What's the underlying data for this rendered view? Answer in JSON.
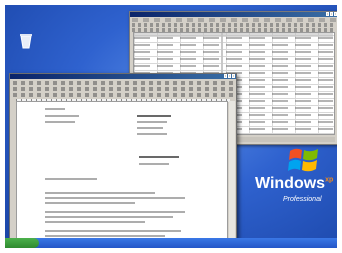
{
  "desktop": {
    "background_color": "#2f62cf",
    "logo": {
      "brand": "Windows",
      "superscript": "xp",
      "edition": "Professional"
    },
    "icons": [
      "recycle-bin-icon"
    ]
  },
  "windows": [
    {
      "app": "spreadsheet",
      "active": false
    },
    {
      "app": "word-processor",
      "active": true
    }
  ]
}
